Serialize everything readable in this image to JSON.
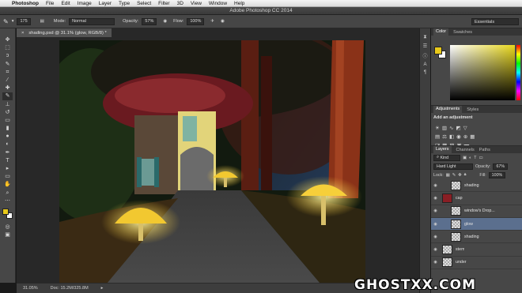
{
  "menubar": {
    "app": "Photoshop",
    "items": [
      "File",
      "Edit",
      "Image",
      "Layer",
      "Type",
      "Select",
      "Filter",
      "3D",
      "View",
      "Window",
      "Help"
    ]
  },
  "titlebar": {
    "title": "Adobe Photoshop CC 2014"
  },
  "options": {
    "brush_size": "175",
    "mode_label": "Mode:",
    "mode_value": "Normal",
    "opacity_label": "Opacity:",
    "opacity_value": "57%",
    "flow_label": "Flow:",
    "flow_value": "100%",
    "workspace": "Essentials"
  },
  "document": {
    "tab_title": "shading.psd @ 31.1% (glow, RGB/8) *",
    "zoom": "31.05%",
    "doc_size": "Doc: 15.2M/325.8M"
  },
  "panels": {
    "color_tabs": [
      "Color",
      "Swatches"
    ],
    "adjust_tabs": [
      "Adjustments",
      "Styles"
    ],
    "add_adjustment": "Add an adjustment",
    "layers_tabs": [
      "Layers",
      "Channels",
      "Paths"
    ],
    "kind_label": "Kind",
    "blend_mode": "Hard Light",
    "layer_opacity_label": "Opacity:",
    "layer_opacity_value": "67%",
    "lock_label": "Lock:",
    "fill_label": "Fill:",
    "fill_value": "100%"
  },
  "layers": [
    {
      "name": "shading",
      "indent": true,
      "selected": false
    },
    {
      "name": "cap",
      "indent": false,
      "selected": false
    },
    {
      "name": "window's Drop...",
      "indent": true,
      "selected": false
    },
    {
      "name": "glow",
      "indent": true,
      "selected": true
    },
    {
      "name": "shading",
      "indent": true,
      "selected": false
    },
    {
      "name": "stem",
      "indent": false,
      "selected": false
    },
    {
      "name": "under",
      "indent": false,
      "selected": false
    }
  ],
  "colors": {
    "foreground": "#e8c91a",
    "background": "#ffffff",
    "selection": "#5b6f8e"
  },
  "watermark": "GHOSTXX.COM"
}
